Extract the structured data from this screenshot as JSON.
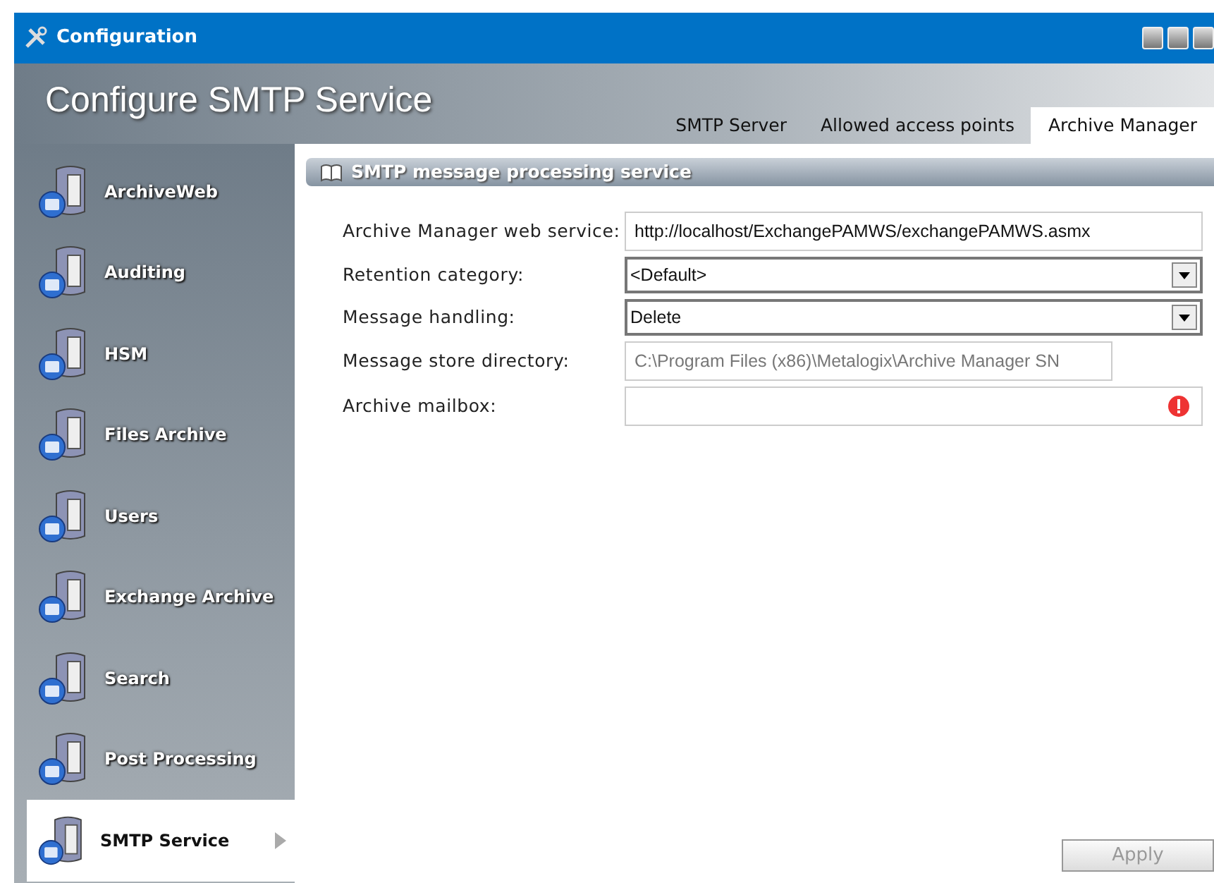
{
  "window": {
    "title": "Configuration"
  },
  "header": {
    "title": "Configure SMTP Service"
  },
  "tabs": [
    {
      "label": "SMTP Server",
      "selected": false
    },
    {
      "label": "Allowed access points",
      "selected": false
    },
    {
      "label": "Archive Manager",
      "selected": true
    }
  ],
  "sidebar": {
    "items": [
      {
        "label": "ArchiveWeb",
        "selected": false
      },
      {
        "label": "Auditing",
        "selected": false
      },
      {
        "label": "HSM",
        "selected": false
      },
      {
        "label": "Files Archive",
        "selected": false
      },
      {
        "label": "Users",
        "selected": false
      },
      {
        "label": "Exchange Archive",
        "selected": false
      },
      {
        "label": "Search",
        "selected": false
      },
      {
        "label": "Post Processing",
        "selected": false
      },
      {
        "label": "SMTP Service",
        "selected": true
      }
    ]
  },
  "section": {
    "title": "SMTP message processing service"
  },
  "fields": [
    {
      "label": "Archive Manager web service:",
      "kind": "text",
      "value": "http://localhost/ExchangePAMWS/exchangePAMWS.asmx"
    },
    {
      "label": "Retention category:",
      "kind": "select",
      "value": "<Default>"
    },
    {
      "label": "Message handling:",
      "kind": "select",
      "value": "Delete"
    },
    {
      "label": "Message store directory:",
      "kind": "readonly",
      "value": "C:\\Program Files (x86)\\Metalogix\\Archive Manager SN"
    },
    {
      "label": "Archive mailbox:",
      "kind": "error"
    }
  ],
  "buttons": [
    {
      "label": "Apply",
      "disabled": true
    }
  ]
}
